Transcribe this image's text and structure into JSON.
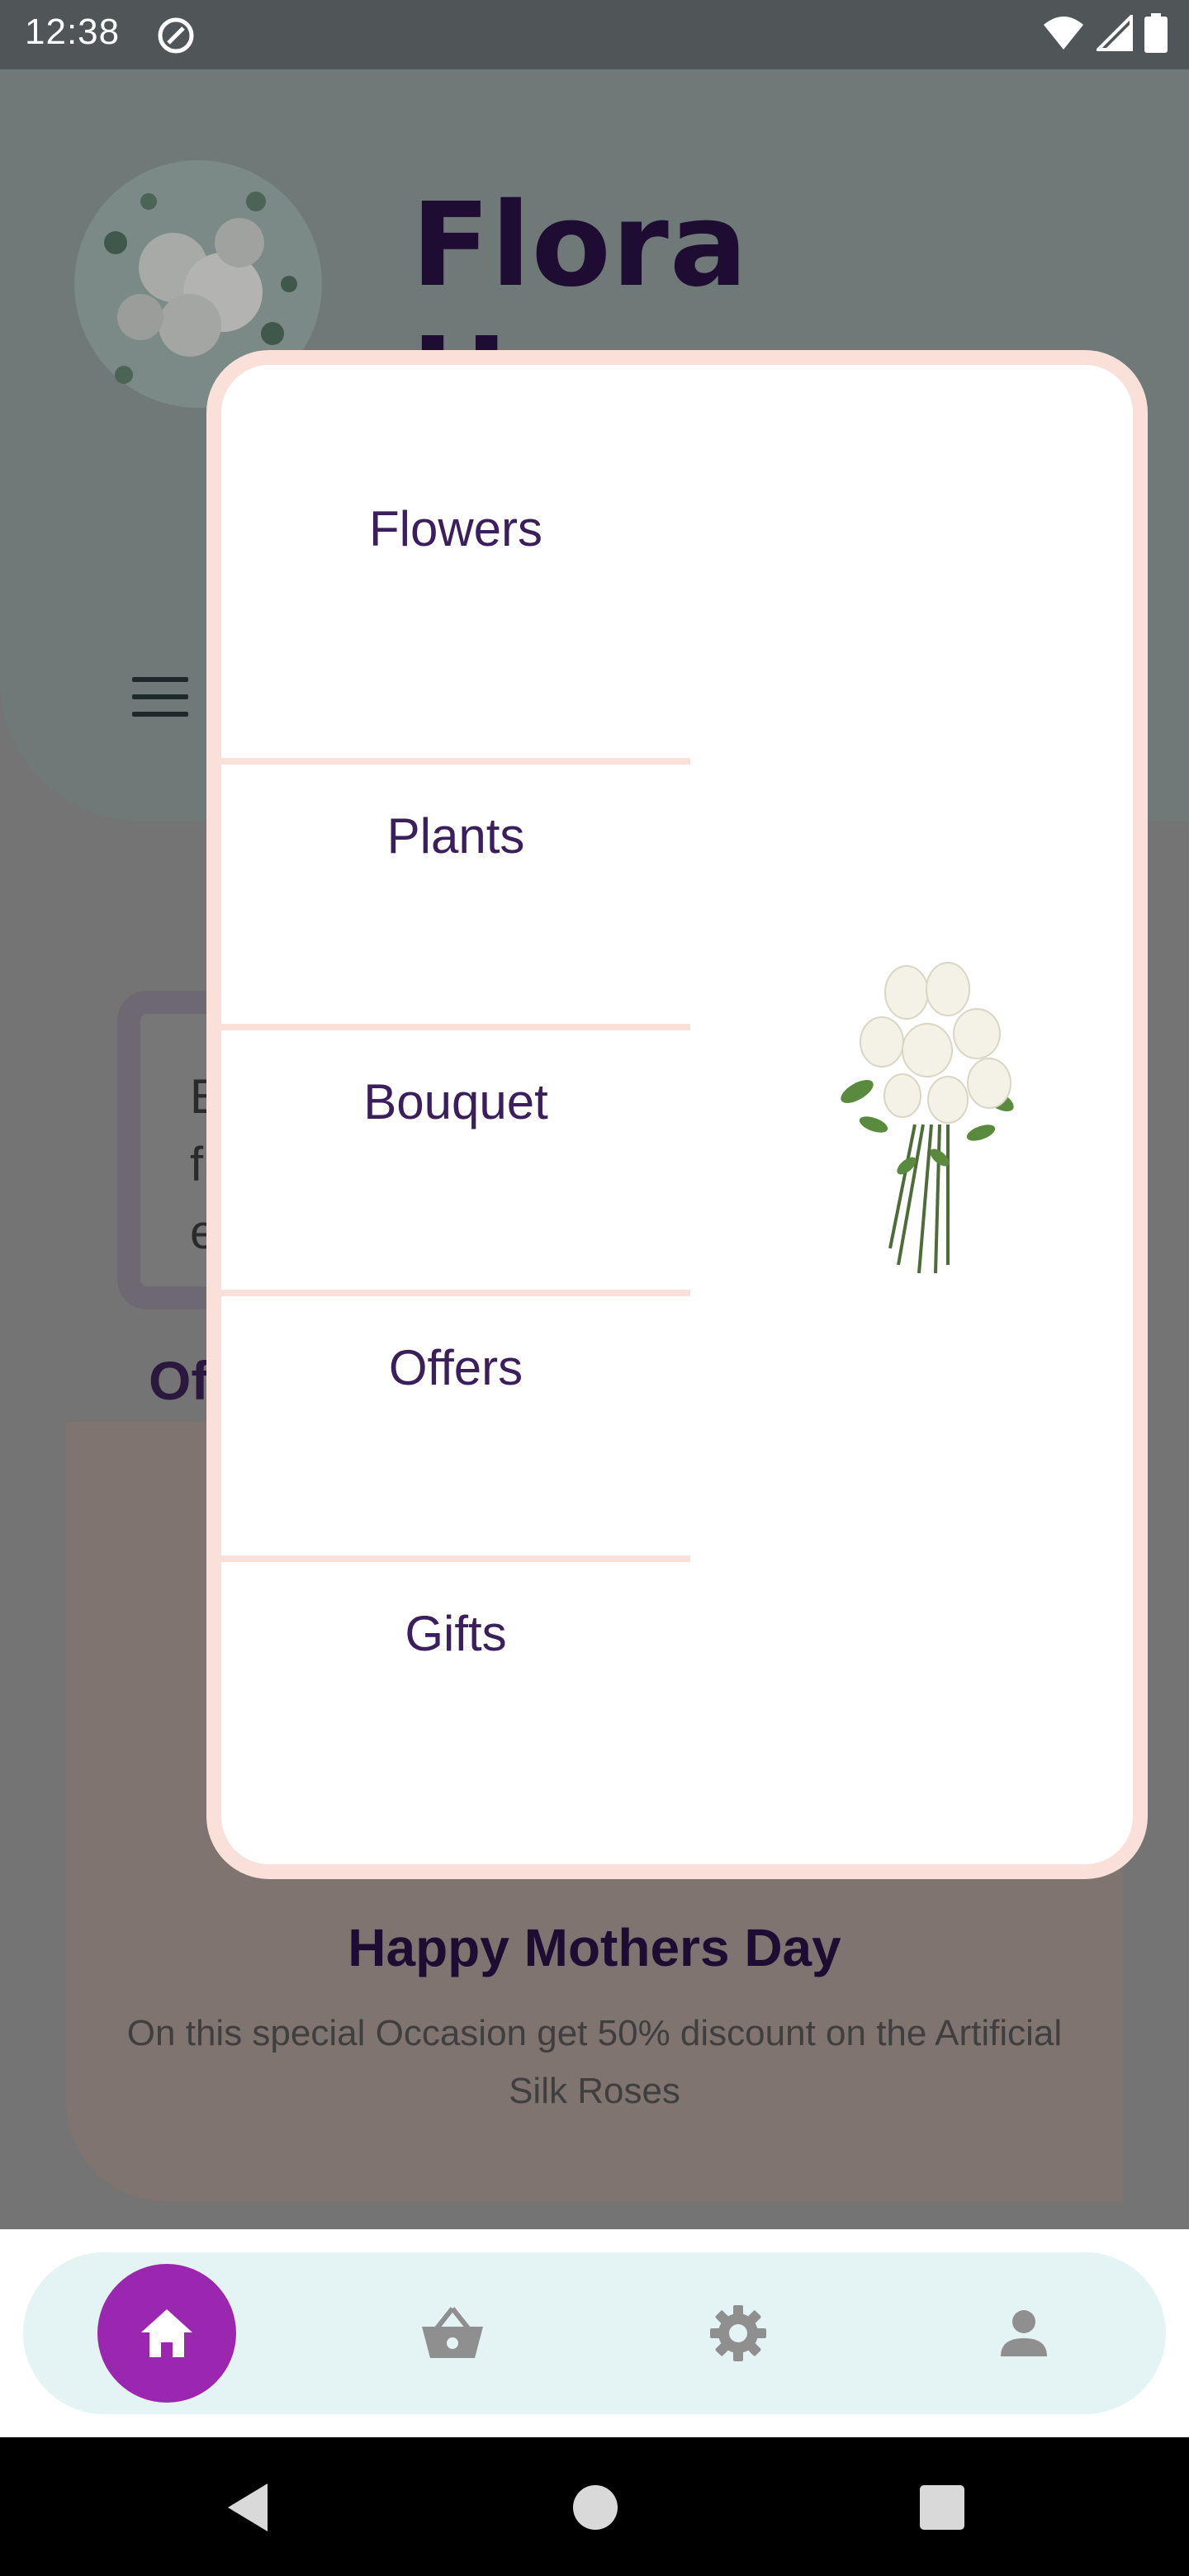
{
  "status_bar": {
    "time": "12:38",
    "icons": [
      "app-notification-icon",
      "wifi-icon",
      "signal-icon",
      "battery-icon"
    ]
  },
  "app": {
    "title": "Flora Haven",
    "hero_text_partial": [
      "Ex",
      "fl",
      "ev"
    ],
    "offers_heading_partial": "Of",
    "offer": {
      "title": "Happy Mothers Day",
      "description": "On this special Occasion get 50% discount on the Artificial Silk Roses"
    }
  },
  "menu_modal": {
    "items": [
      {
        "label": "Flowers"
      },
      {
        "label": "Plants"
      },
      {
        "label": "Bouquet"
      },
      {
        "label": "Offers"
      },
      {
        "label": "Gifts"
      }
    ],
    "image": "white-roses-bouquet-image"
  },
  "bottom_nav": {
    "items": [
      {
        "icon": "home-icon",
        "active": true
      },
      {
        "icon": "basket-icon",
        "active": false
      },
      {
        "icon": "settings-icon",
        "active": false
      },
      {
        "icon": "profile-icon",
        "active": false
      }
    ],
    "active_color": "#9b27b0"
  },
  "system_nav": [
    "back-icon",
    "home-circle-icon",
    "recents-icon"
  ]
}
